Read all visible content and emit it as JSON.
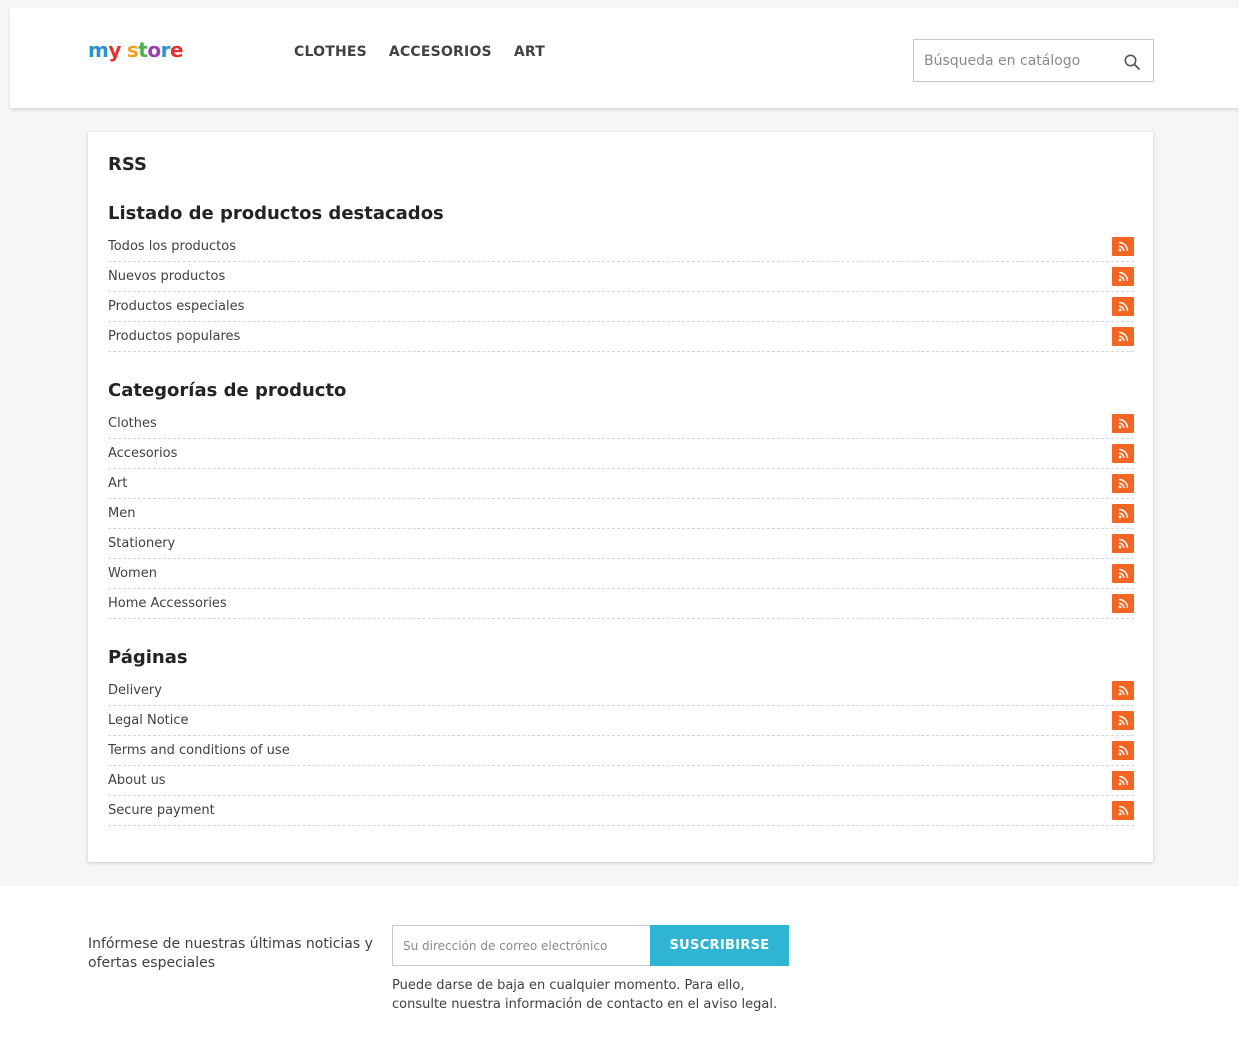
{
  "header": {
    "logo": {
      "text": "my store"
    },
    "nav": [
      "CLOTHES",
      "ACCESORIOS",
      "ART"
    ],
    "search": {
      "placeholder": "Búsqueda en catálogo",
      "value": ""
    }
  },
  "page": {
    "title": "RSS",
    "sections": [
      {
        "heading": "Listado de productos destacados",
        "items": [
          "Todos los productos",
          "Nuevos productos",
          "Productos especiales",
          "Productos populares"
        ]
      },
      {
        "heading": "Categorías de producto",
        "items": [
          "Clothes",
          "Accesorios",
          "Art",
          "Men",
          "Stationery",
          "Women",
          "Home Accessories"
        ]
      },
      {
        "heading": "Páginas",
        "items": [
          "Delivery",
          "Legal Notice",
          "Terms and conditions of use",
          "About us",
          "Secure payment"
        ]
      }
    ]
  },
  "footer": {
    "newsletter_text": "Infórmese de nuestras últimas noticias y ofertas especiales",
    "email_placeholder": "Su dirección de correo electrónico",
    "subscribe_label": "SUSCRIBIRSE",
    "note": "Puede darse de baja en cualquier momento. Para ello, consulte nuestra información de contacto en el aviso legal."
  },
  "icons": {
    "feed": "rss-icon",
    "search": "search-icon"
  },
  "colors": {
    "rss": "#f26522",
    "accent": "#2fb5d2"
  }
}
